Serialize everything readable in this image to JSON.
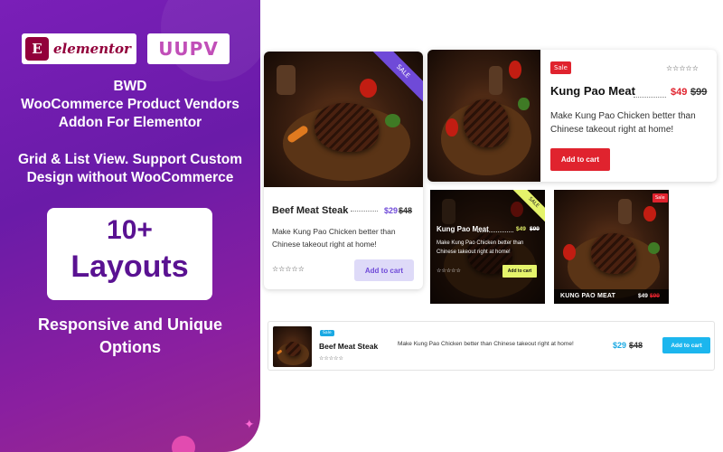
{
  "brand": {
    "elementor_mark": "E",
    "elementor_name": "elementor",
    "partner_logo": "UUPV"
  },
  "promo": {
    "title_lines": [
      "BWD",
      "WooCommerce Product Vendors",
      "Addon For Elementor"
    ],
    "subtitle_lines": [
      "Grid & List View.  Support Custom",
      "Design without WooCommerce"
    ],
    "layouts_count": "10+",
    "layouts_word": "Layouts",
    "footer_lines": [
      "Responsive and Unique",
      "Options"
    ]
  },
  "cards": {
    "grid": {
      "badge": "SALE",
      "name": "Beef Meat Steak",
      "price": "$29",
      "old_price": "$48",
      "description": "Make Kung Pao Chicken better than Chinese takeout right at home!",
      "rating": "☆☆☆☆☆",
      "button": "Add to cart"
    },
    "list": {
      "badge": "Sale",
      "name": "Kung Pao Meat",
      "price": "$49",
      "old_price": "$99",
      "description": "Make Kung Pao Chicken better than Chinese takeout right at home!",
      "rating": "☆☆☆☆☆",
      "button": "Add to cart"
    },
    "overlay": {
      "badge": "SALE",
      "name": "Kung Pao Meat",
      "price": "$49",
      "old_price": "$99",
      "description": "Make Kung Pao Chicken better than Chinese takeout right at home!",
      "rating": "☆☆☆☆☆",
      "button": "Add to cart"
    },
    "image_bar": {
      "badge": "Sale",
      "name": "KUNG PAO MEAT",
      "price": "$49",
      "old_price": "$99"
    },
    "row": {
      "badge": "Sale",
      "name": "Beef Meat Steak",
      "rating": "☆☆☆☆☆",
      "description": "Make Kung Pao Chicken better than Chinese takeout right at home!",
      "price": "$29",
      "old_price": "$48",
      "button": "Add to cart"
    }
  },
  "colors": {
    "promo_purple": "#7a1fb8",
    "grid_accent": "#6f4ad8",
    "list_accent": "#e0232e",
    "overlay_accent": "#e5f36b",
    "row_accent": "#1cb6ee"
  }
}
